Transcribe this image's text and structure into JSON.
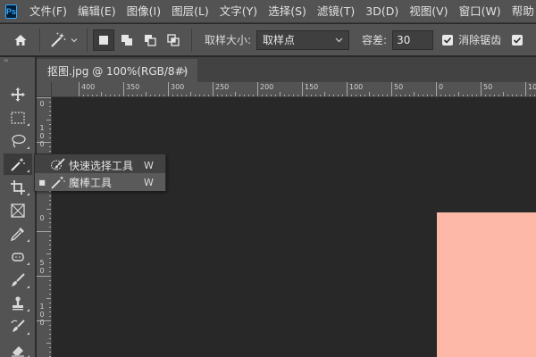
{
  "app": {
    "logo_text": "Ps"
  },
  "menu": {
    "items": [
      "文件(F)",
      "编辑(E)",
      "图像(I)",
      "图层(L)",
      "文字(Y)",
      "选择(S)",
      "滤镜(T)",
      "3D(D)",
      "视图(V)",
      "窗口(W)",
      "帮助"
    ]
  },
  "options": {
    "sample_size_label": "取样大小:",
    "sample_size_value": "取样点",
    "tolerance_label": "容差:",
    "tolerance_value": "30",
    "antialias_label": "消除锯齿",
    "antialias_checked": true
  },
  "toolbox": {
    "collapse_glyph": "››",
    "tools": [
      "move-tool",
      "marquee-tool",
      "lasso-tool",
      "magic-wand-tool",
      "crop-tool",
      "frame-tool",
      "eyedropper-tool",
      "healing-tool",
      "brush-tool",
      "stamp-tool",
      "history-brush-tool",
      "eraser-tool"
    ]
  },
  "document": {
    "tab_title": "抠图.jpg @ 100%(RGB/8#)",
    "close_glyph": "×"
  },
  "ruler": {
    "h_labels": [
      "400",
      "350",
      "300",
      "250",
      "200",
      "150",
      "100",
      "50",
      "0",
      "50",
      "100"
    ],
    "v_labels": [
      "0",
      "1 0 0",
      "5 0",
      "0",
      "5 0",
      "1 0 0"
    ]
  },
  "flyout": {
    "items": [
      {
        "label": "快速选择工具",
        "shortcut": "W",
        "selected": false
      },
      {
        "label": "魔棒工具",
        "shortcut": "W",
        "selected": true
      }
    ]
  },
  "colors": {
    "image_fill": "#fdb8a8",
    "canvas_bg": "#282828",
    "panel_bg": "#535353"
  }
}
